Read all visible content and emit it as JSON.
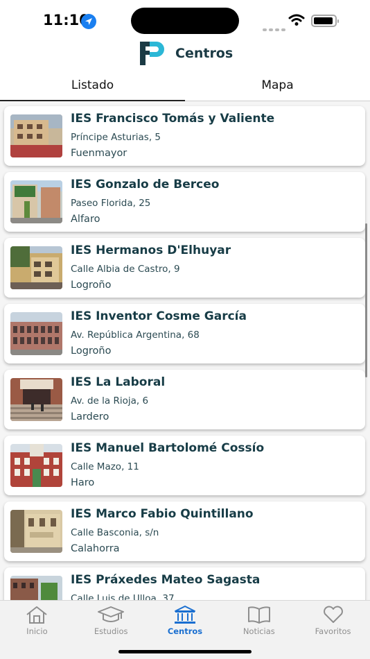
{
  "status_bar": {
    "time": "11:10"
  },
  "header": {
    "title": "Centros"
  },
  "tabs": [
    {
      "label": "Listado",
      "active": true
    },
    {
      "label": "Mapa",
      "active": false
    }
  ],
  "centers": [
    {
      "name": "IES Francisco Tomás y Valiente",
      "address": "Príncipe Asturias, 5",
      "town": "Fuenmayor"
    },
    {
      "name": "IES Gonzalo de Berceo",
      "address": "Paseo Florida, 25",
      "town": "Alfaro"
    },
    {
      "name": "IES Hermanos D'Elhuyar",
      "address": "Calle Albia de Castro, 9",
      "town": "Logroño"
    },
    {
      "name": "IES Inventor Cosme García",
      "address": "Av. República Argentina, 68",
      "town": "Logroño"
    },
    {
      "name": "IES La Laboral",
      "address": "Av. de la Rioja, 6",
      "town": "Lardero"
    },
    {
      "name": "IES Manuel Bartolomé Cossío",
      "address": "Calle Mazo, 11",
      "town": "Haro"
    },
    {
      "name": "IES Marco Fabio Quintillano",
      "address": "Calle Basconia, s/n",
      "town": "Calahorra"
    },
    {
      "name": "IES Práxedes Mateo Sagasta",
      "address": "Calle Luis de Ulloa, 37",
      "town": ""
    }
  ],
  "bottom_nav": [
    {
      "label": "Inicio",
      "icon": "home-icon",
      "active": false
    },
    {
      "label": "Estudios",
      "icon": "graduation-cap-icon",
      "active": false
    },
    {
      "label": "Centros",
      "icon": "institution-icon",
      "active": true
    },
    {
      "label": "Noticias",
      "icon": "book-icon",
      "active": false
    },
    {
      "label": "Favoritos",
      "icon": "heart-icon",
      "active": false
    }
  ],
  "colors": {
    "brand_dark": "#1b3a44",
    "brand_accent": "#2bb7d6",
    "active_tab": "#1a6fd0",
    "inactive_tab": "#8e8e8e"
  }
}
